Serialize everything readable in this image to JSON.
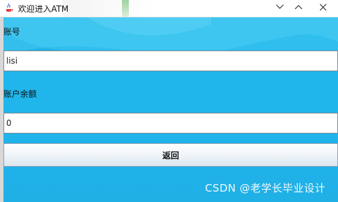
{
  "window": {
    "title": "欢迎进入ATM",
    "icon": "java-coffee-icon",
    "controls": [
      "minimize-icon",
      "maximize-icon",
      "close-icon"
    ]
  },
  "form": {
    "account_label": "账号",
    "account_value": "lisi",
    "balance_label": "账户余额",
    "balance_value": "0",
    "back_button": "返回"
  },
  "watermark": "CSDN @老学长毕业设计",
  "colors": {
    "background": "#20b6ec",
    "button_border": "#8ea0b0",
    "field_border": "#7a8a94"
  }
}
